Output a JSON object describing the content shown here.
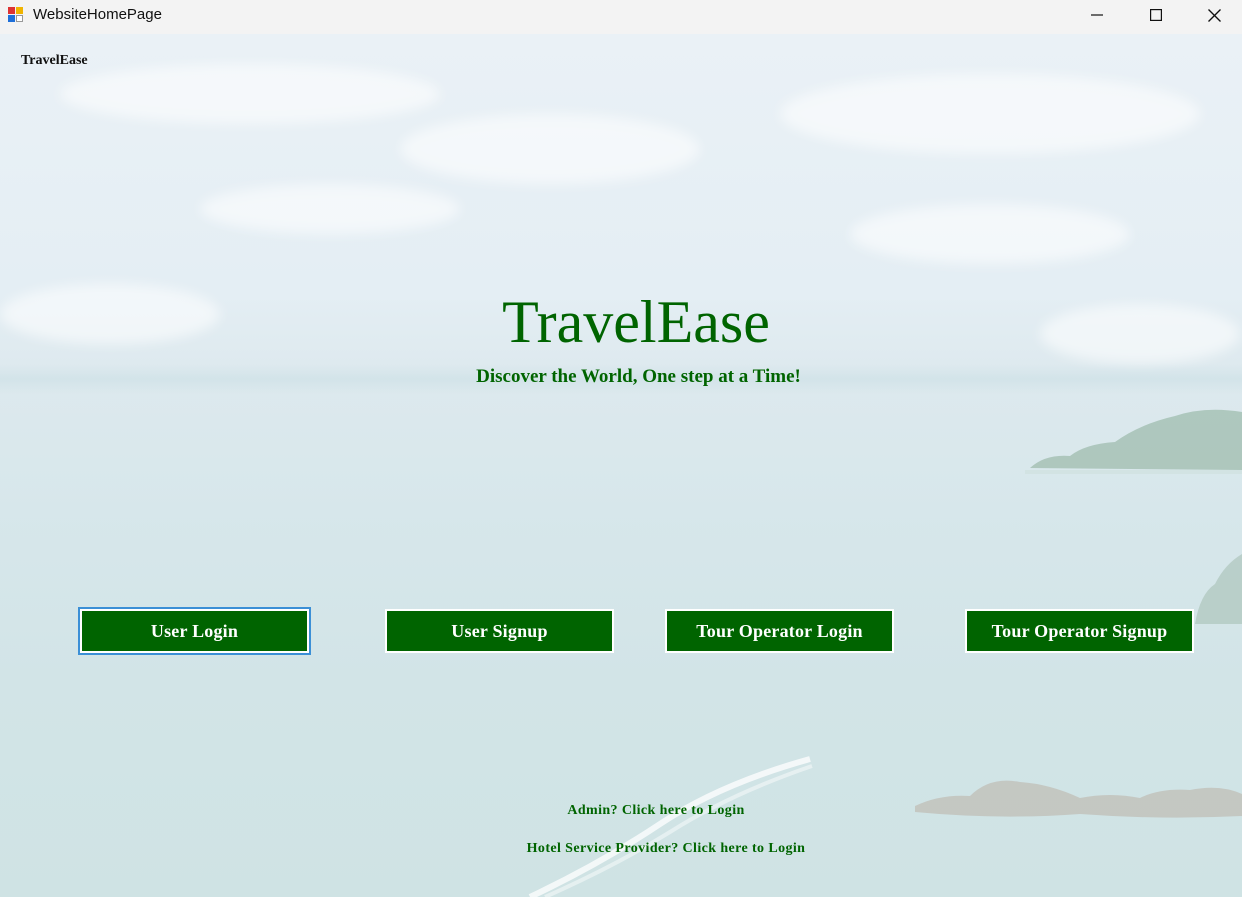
{
  "window": {
    "title": "WebsiteHomePage",
    "minimize_icon": "minimize-icon",
    "maximize_icon": "maximize-icon",
    "close_icon": "close-icon"
  },
  "header": {
    "brand": "TravelEase"
  },
  "hero": {
    "title": "TravelEase",
    "tagline": "Discover the World, One step at a Time!"
  },
  "buttons": {
    "user_login": "User Login",
    "user_signup": "User Signup",
    "tour_operator_login": "Tour Operator Login",
    "tour_operator_signup": "Tour Operator Signup"
  },
  "links": {
    "admin_login": "Admin? Click here to Login",
    "hotel_login": "Hotel Service Provider? Click here to Login"
  },
  "colors": {
    "brand_green": "#006400",
    "button_text": "#ffffff",
    "focus_outline": "#3b8fd6"
  }
}
